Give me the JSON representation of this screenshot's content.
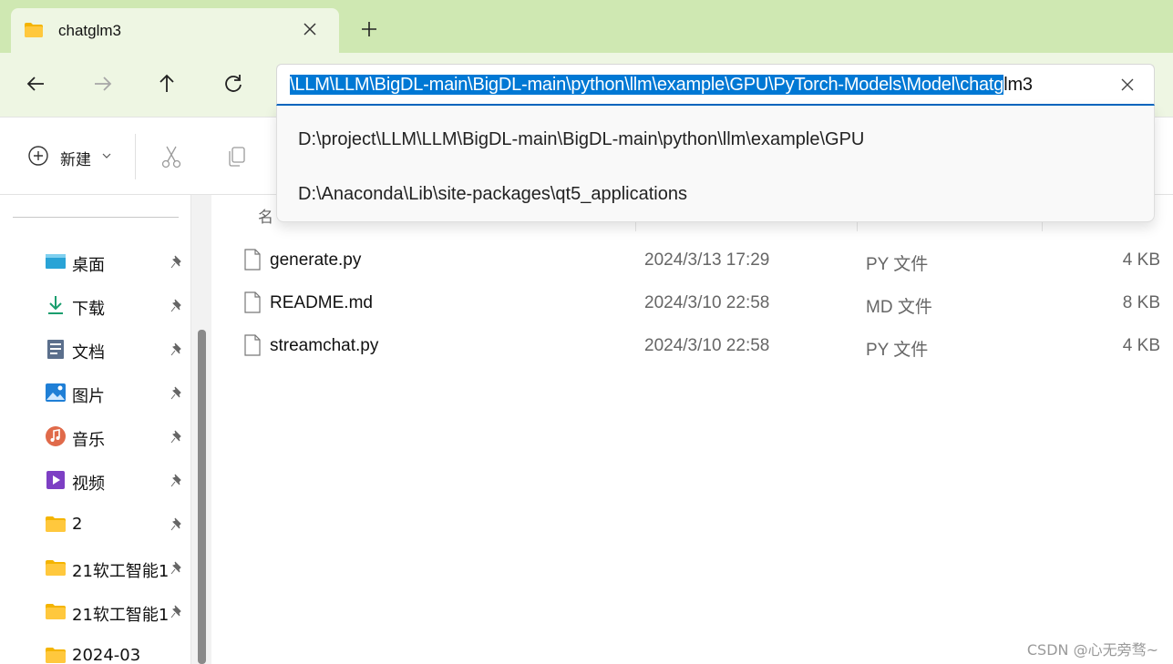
{
  "tab": {
    "title": "chatglm3"
  },
  "address": {
    "selected_text": "\\LLM\\LLM\\BigDL-main\\BigDL-main\\python\\llm\\example\\GPU\\PyTorch-Models\\Model\\chatg",
    "rest_text": "lm3"
  },
  "suggestions": [
    "D:\\project\\LLM\\LLM\\BigDL-main\\BigDL-main\\python\\llm\\example\\GPU",
    "D:\\Anaconda\\Lib\\site-packages\\qt5_applications"
  ],
  "toolbar": {
    "new_label": "新建"
  },
  "columns": {
    "name": "名"
  },
  "sidebar": {
    "items": [
      {
        "label": "桌面",
        "icon": "desktop-icon"
      },
      {
        "label": "下载",
        "icon": "download-icon"
      },
      {
        "label": "文档",
        "icon": "documents-icon"
      },
      {
        "label": "图片",
        "icon": "pictures-icon"
      },
      {
        "label": "音乐",
        "icon": "music-icon"
      },
      {
        "label": "视频",
        "icon": "videos-icon"
      },
      {
        "label": "2",
        "icon": "folder-icon"
      },
      {
        "label": "21软工智能1",
        "icon": "folder-icon"
      },
      {
        "label": "21软工智能1",
        "icon": "folder-icon"
      },
      {
        "label": "2024-03",
        "icon": "folder-icon"
      }
    ]
  },
  "files": [
    {
      "name": "generate.py",
      "date": "2024/3/13 17:29",
      "type": "PY 文件",
      "size": "4 KB"
    },
    {
      "name": "README.md",
      "date": "2024/3/10 22:58",
      "type": "MD 文件",
      "size": "8 KB"
    },
    {
      "name": "streamchat.py",
      "date": "2024/3/10 22:58",
      "type": "PY 文件",
      "size": "4 KB"
    }
  ],
  "watermark": "CSDN @心无旁骛~",
  "colors": {
    "accent": "#0078d4",
    "tabbar": "#cfe8b2",
    "navbar": "#eef6e3"
  }
}
